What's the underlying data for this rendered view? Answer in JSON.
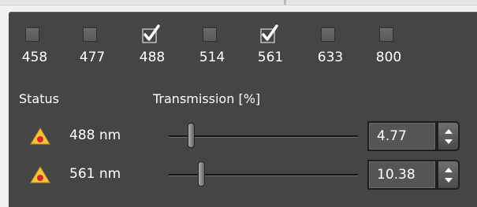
{
  "lasers": [
    {
      "label": "458",
      "checked": false
    },
    {
      "label": "477",
      "checked": false
    },
    {
      "label": "488",
      "checked": true
    },
    {
      "label": "514",
      "checked": false
    },
    {
      "label": "561",
      "checked": true
    },
    {
      "label": "633",
      "checked": false
    },
    {
      "label": "800",
      "checked": false
    }
  ],
  "headers": {
    "status": "Status",
    "transmission": "Transmission [%]"
  },
  "rows": [
    {
      "status_icon": "warning-icon",
      "wavelength": "488 nm",
      "slider_fraction": 0.0477,
      "value": "4.77"
    },
    {
      "status_icon": "warning-icon",
      "wavelength": "561 nm",
      "slider_fraction": 0.1038,
      "value": "10.38"
    }
  ],
  "colors": {
    "panel": "#454545",
    "text": "#ffffff",
    "warning_fill": "#f2c53a",
    "warning_dot": "#d8252a"
  }
}
